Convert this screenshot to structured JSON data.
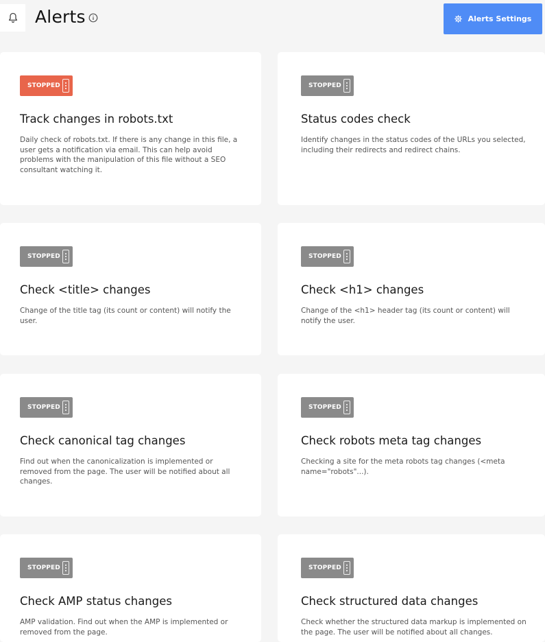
{
  "header": {
    "title": "Alerts",
    "settings_label": "Alerts Settings"
  },
  "cards": [
    {
      "status": "STOPPED",
      "title": "Track changes in robots.txt",
      "desc": "Daily check of robots.txt. If there is any change in this file, a user gets a notification via email. This can help avoid problems with the manipulation of this file without a SEO consultant watching it."
    },
    {
      "status": "STOPPED",
      "title": "Status codes check",
      "desc": "Identify changes in the status codes of the URLs you selected, including their redirects and redirect chains."
    },
    {
      "status": "STOPPED",
      "title": "Check <title> changes",
      "desc": "Change of the title tag (its count or content) will notify the user."
    },
    {
      "status": "STOPPED",
      "title": "Check <h1> changes",
      "desc": "Change of the <h1> header tag (its count or content) will notify the user."
    },
    {
      "status": "STOPPED",
      "title": "Check canonical tag changes",
      "desc": "Find out when the canonicalization is implemented or removed from the page. The user will be notified about all changes."
    },
    {
      "status": "STOPPED",
      "title": "Check robots meta tag changes",
      "desc": "Checking a site for the meta robots tag changes (<meta name=\"robots\"...)."
    },
    {
      "status": "STOPPED",
      "title": "Check AMP status changes",
      "desc": "AMP validation. Find out when the AMP is implemented or removed from the page."
    },
    {
      "status": "STOPPED",
      "title": "Check structured data changes",
      "desc": "Check whether the structured data markup is implemented on the page. The user will be notified about all changes."
    }
  ],
  "colors": {
    "accent": "#4f8cf6",
    "stopped_active": "#e8654b",
    "stopped": "#8a8a8a"
  }
}
